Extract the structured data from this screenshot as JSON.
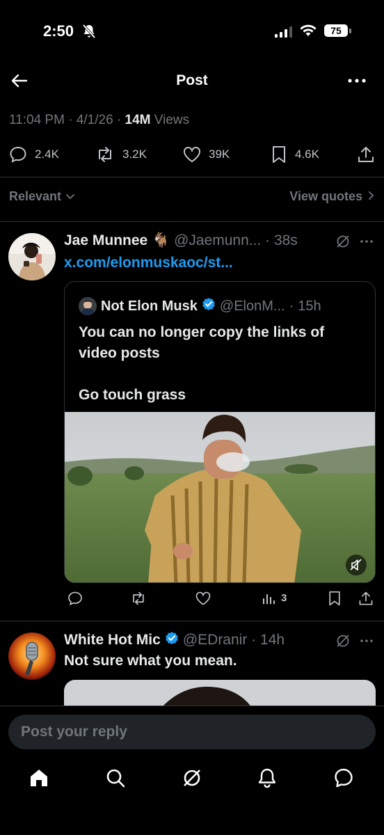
{
  "status": {
    "time": "2:50",
    "battery": "75"
  },
  "nav": {
    "title": "Post"
  },
  "post": {
    "time": "11:04 PM",
    "date": "4/1/26",
    "views_count": "14M",
    "views_label": "Views",
    "replies": "2.4K",
    "reposts": "3.2K",
    "likes": "39K",
    "bookmarks": "4.6K"
  },
  "sort": {
    "left_label": "Relevant",
    "right_label": "View quotes"
  },
  "reply1": {
    "name": "Jae Munnee",
    "emoji": "🐐",
    "handle": "@Jaemunn...",
    "age": "38s",
    "link": "x.com/elonmuskaoc/st...",
    "quote": {
      "name": "Not Elon Musk",
      "handle": "@ElonM...",
      "age": "15h",
      "text_line1": "You can no longer copy the links of video posts",
      "text_line2": "Go touch grass"
    },
    "views": "3"
  },
  "reply2": {
    "name": "White Hot Mic",
    "handle": "@EDranir",
    "age": "14h",
    "text": "Not sure what you mean."
  },
  "compose": {
    "placeholder": "Post your reply"
  },
  "colors": {
    "background": "#000000",
    "accent": "#1d9bf0",
    "muted": "#71767b",
    "verified": "#1d9bf0"
  }
}
